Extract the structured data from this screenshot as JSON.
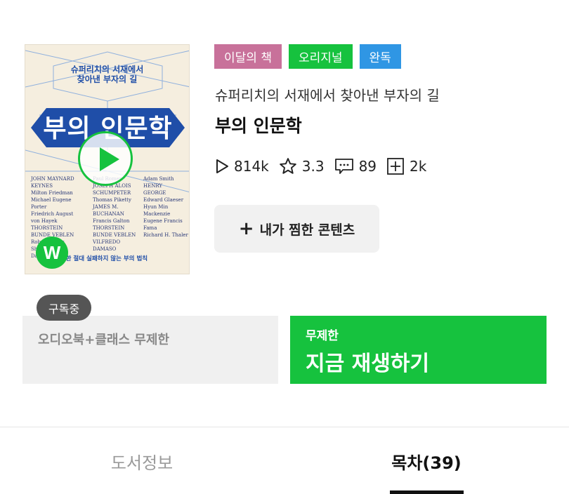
{
  "book": {
    "cover": {
      "subtitle_line1": "슈퍼리치의 서재에서",
      "subtitle_line2": "찾아낸 부자의 길",
      "title": "부의 인문학",
      "names_col1": [
        "JOHN MAYNARD",
        "KEYNES",
        "Milton Friedman",
        "Michael Eugene Porter",
        "Friedrich August von Hayek",
        "THORSTEIN",
        "BUNDE VEBLEN",
        "Robert James Shiller",
        "Daniel"
      ],
      "names_col2": [
        "Paul Romer",
        "JOSEPH ALOIS",
        "SCHUMPETER",
        "Thomas Piketty",
        "JAMES M. BUCHANAN",
        "Francis Galton",
        "THORSTEIN",
        "BUNDE VEBLEN",
        "VILFREDO",
        "DAMASO"
      ],
      "names_col3": [
        "Adam Smith",
        "HENRY",
        "GEORGE",
        "Edward Glaeser",
        "Hyun Min Mackenzie",
        "Eugene Francis",
        "Fama",
        "Richard H. Thaler"
      ],
      "tagline": "검증한 절대 실패하지 않는 부의 법칙",
      "badge_letter": "W"
    },
    "badges": [
      "이달의 책",
      "오리지널",
      "완독"
    ],
    "subtitle": "슈퍼리치의 서재에서 찾아낸 부자의 길",
    "title": "부의 인문학",
    "stats": {
      "plays": "814k",
      "rating": "3.3",
      "comments": "89",
      "adds": "2k"
    },
    "wish_label": "내가 찜한 콘텐츠"
  },
  "subscription": {
    "status_tag": "구독중",
    "plan_label": "오디오북+클래스 무제한",
    "play_small": "무제한",
    "play_big": "지금 재생하기"
  },
  "tabs": [
    {
      "label": "도서정보",
      "active": false
    },
    {
      "label": "목차(39)",
      "active": true
    }
  ],
  "colors": {
    "accent_green": "#16c23e",
    "badge_pink": "#c8719a",
    "badge_blue": "#2f96e4"
  }
}
